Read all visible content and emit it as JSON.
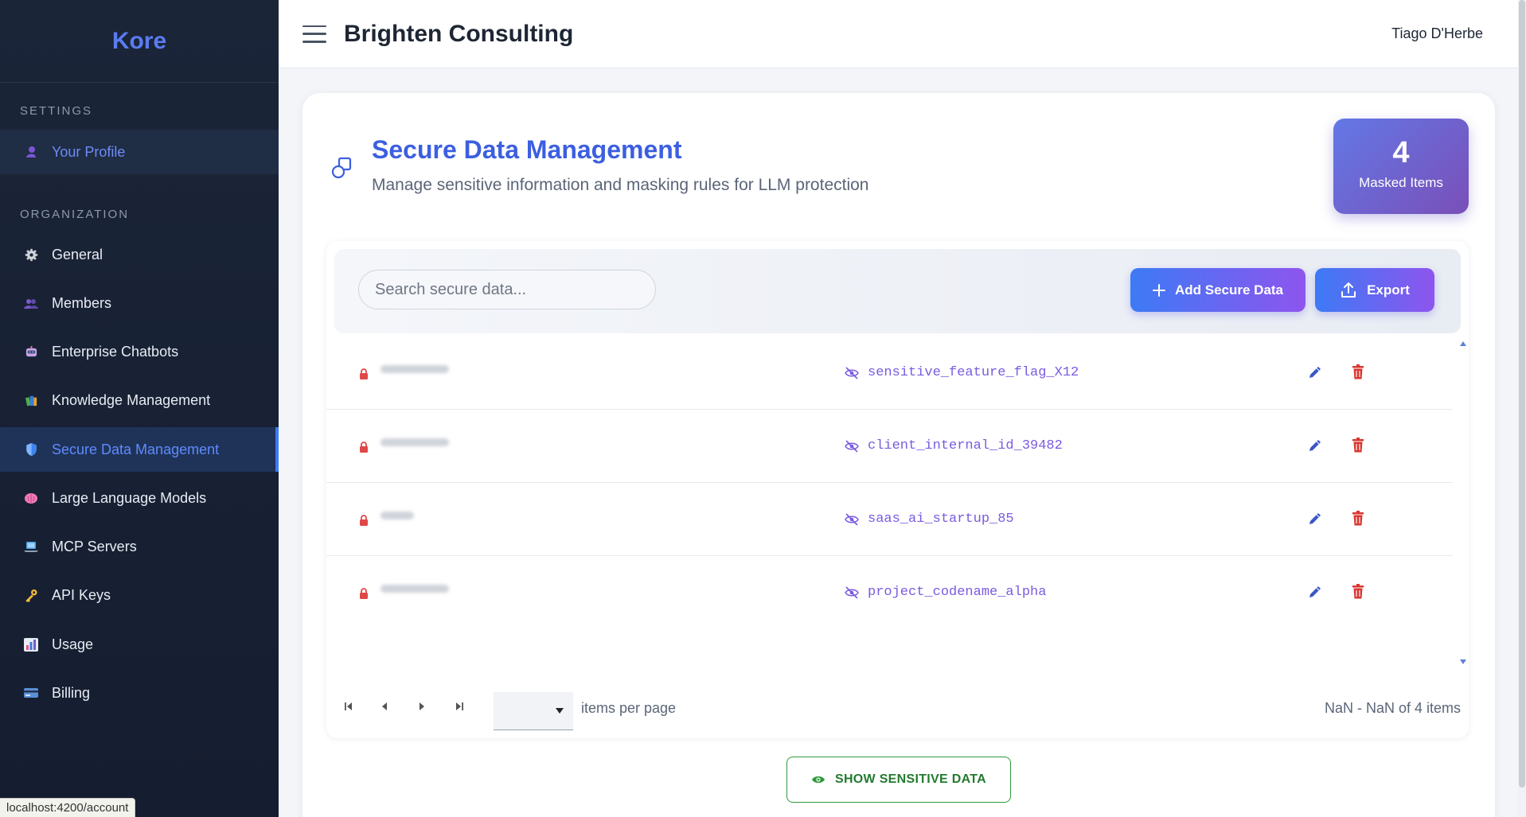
{
  "sidebar": {
    "brand": "Kore",
    "settings_label": "SETTINGS",
    "organization_label": "ORGANIZATION",
    "profile": {
      "label": "Your Profile",
      "icon": "user-icon"
    },
    "items": [
      {
        "label": "General",
        "icon": "gear-icon"
      },
      {
        "label": "Members",
        "icon": "members-icon"
      },
      {
        "label": "Enterprise Chatbots",
        "icon": "robot-icon"
      },
      {
        "label": "Knowledge Management",
        "icon": "books-icon"
      },
      {
        "label": "Secure Data Management",
        "icon": "shield-icon",
        "active": true
      },
      {
        "label": "Large Language Models",
        "icon": "brain-icon"
      },
      {
        "label": "MCP Servers",
        "icon": "laptop-icon"
      },
      {
        "label": "API Keys",
        "icon": "key-icon"
      },
      {
        "label": "Usage",
        "icon": "bar-chart-icon"
      },
      {
        "label": "Billing",
        "icon": "credit-card-icon"
      }
    ]
  },
  "header": {
    "org_name": "Brighten Consulting",
    "user_name": "Tiago D'Herbe"
  },
  "page": {
    "title": "Secure Data Management",
    "subtitle": "Manage sensitive information and masking rules for LLM protection",
    "stat": {
      "value": "4",
      "label": "Masked Items"
    }
  },
  "toolbar": {
    "search_placeholder": "Search secure data...",
    "add_label": "Add Secure Data",
    "export_label": "Export"
  },
  "rows": [
    {
      "token": "sensitive_feature_flag_X12"
    },
    {
      "token": "client_internal_id_39482"
    },
    {
      "token": "saas_ai_startup_85"
    },
    {
      "token": "project_codename_alpha"
    }
  ],
  "pager": {
    "items_per_page_label": "items per page",
    "range_label": "NaN - NaN of 4 items"
  },
  "show_sensitive_label": "SHOW SENSITIVE DATA",
  "status_url": "localhost:4200/account",
  "colors": {
    "accent": "#3c5fe0",
    "sidebar_bg": "#1b2538",
    "danger": "#d9362f",
    "success": "#237a2f"
  }
}
